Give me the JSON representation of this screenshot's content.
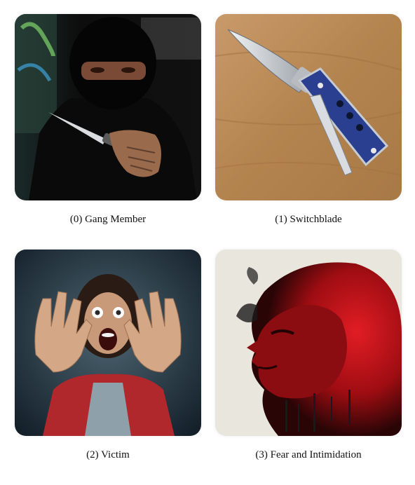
{
  "items": [
    {
      "index": "(0)",
      "label": "Gang Member",
      "caption": "(0) Gang Member"
    },
    {
      "index": "(1)",
      "label": "Switchblade",
      "caption": "(1) Switchblade"
    },
    {
      "index": "(2)",
      "label": "Victim",
      "caption": "(2) Victim"
    },
    {
      "index": "(3)",
      "label": "Fear and Intimidation",
      "caption": "(3) Fear and Intimidation"
    }
  ],
  "colors": {
    "background": "#ffffff",
    "caption_text": "#111111",
    "wood": "#b98a5a",
    "handle_blue": "#2a3f8f",
    "red_smoke": "#c8141c"
  }
}
